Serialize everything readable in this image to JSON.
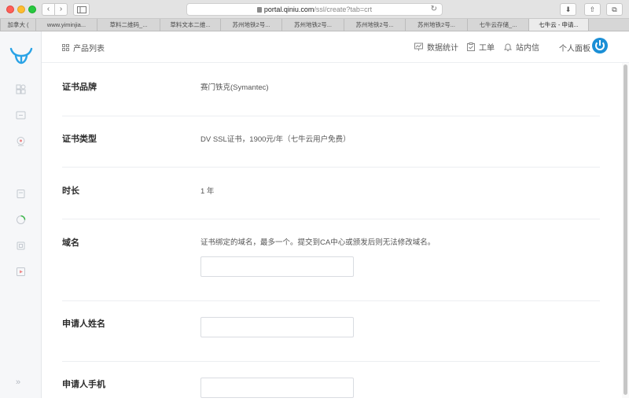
{
  "browser": {
    "url_domain": "portal.qiniu.com",
    "url_path": "/ssl/create?tab=crt",
    "tabs": [
      {
        "label": "加拿大 ( ",
        "width": 45
      },
      {
        "label": "www.yiminjia...",
        "width": 78
      },
      {
        "label": "草料二维码_...",
        "width": 80
      },
      {
        "label": "草料文本二维...",
        "width": 77
      },
      {
        "label": "苏州地铁2号...",
        "width": 78
      },
      {
        "label": "苏州地铁2号...",
        "width": 79
      },
      {
        "label": "苏州地铁2号...",
        "width": 78
      },
      {
        "label": "苏州地铁2号...",
        "width": 79
      },
      {
        "label": "七牛云存储_...",
        "width": 78
      },
      {
        "label": "七牛云 - 申请...",
        "width": 76,
        "active": true
      },
      {
        "label": "",
        "width": 32
      }
    ]
  },
  "header": {
    "product_list": "产品列表",
    "stats": "数据统计",
    "ticket": "工单",
    "messages": "站内信",
    "personal_panel": "个人面板"
  },
  "form": {
    "brand": {
      "label": "证书品牌",
      "value": "赛门铁克(Symantec)"
    },
    "type": {
      "label": "证书类型",
      "value": "DV SSL证书，1900元/年（七牛云用户免费）"
    },
    "duration": {
      "label": "时长",
      "value": "1 年"
    },
    "domain": {
      "label": "域名",
      "hint": "证书绑定的域名，最多一个。提交到CA中心或颁发后则无法修改域名。",
      "placeholder": ""
    },
    "applicant_name": {
      "label": "申请人姓名",
      "placeholder": ""
    },
    "applicant_phone": {
      "label": "申请人手机",
      "placeholder": ""
    }
  },
  "colors": {
    "brand_blue": "#1b8fd6",
    "logo_blue": "#2aa3e6"
  }
}
